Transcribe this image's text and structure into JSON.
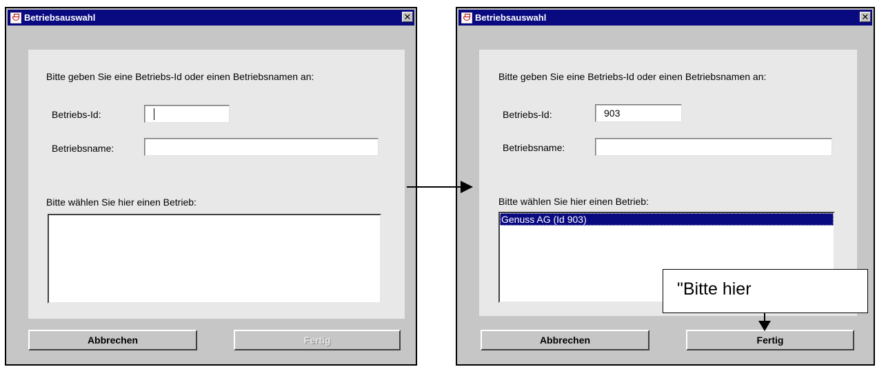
{
  "left_dialog": {
    "title": "Betriebsauswahl",
    "close_glyph": "✕",
    "prompt": "Bitte geben Sie eine Betriebs-Id oder einen Betriebsnamen an:",
    "id_label": "Betriebs-Id:",
    "id_value": "",
    "name_label": "Betriebsname:",
    "name_value": "",
    "list_label": "Bitte wählen Sie hier einen Betrieb:",
    "list_items": [],
    "cancel_label": "Abbrechen",
    "done_label": "Fertig",
    "done_enabled": false
  },
  "right_dialog": {
    "title": "Betriebsauswahl",
    "close_glyph": "✕",
    "prompt": "Bitte geben Sie eine Betriebs-Id oder einen Betriebsnamen an:",
    "id_label": "Betriebs-Id:",
    "id_value": "903",
    "name_label": "Betriebsname:",
    "name_value": "",
    "list_label": "Bitte wählen Sie hier einen Betrieb:",
    "list_items": [
      "Genuss AG (Id 903)"
    ],
    "selected_item": "Genuss AG (Id 903)",
    "cancel_label": "Abbrechen",
    "done_label": "Fertig",
    "done_enabled": true
  },
  "callout": {
    "text": "\"Bitte hier"
  },
  "icons": {
    "title_icon": "application-icon",
    "close_icon": "close-icon",
    "transition_arrow": "arrow-right-icon",
    "callout_arrow": "arrow-down-icon"
  },
  "colors": {
    "titlebar": "#0a0a80",
    "window_bg": "#c6c6c6",
    "panel_bg": "#e8e8e8",
    "selection": "#0a0a80"
  }
}
